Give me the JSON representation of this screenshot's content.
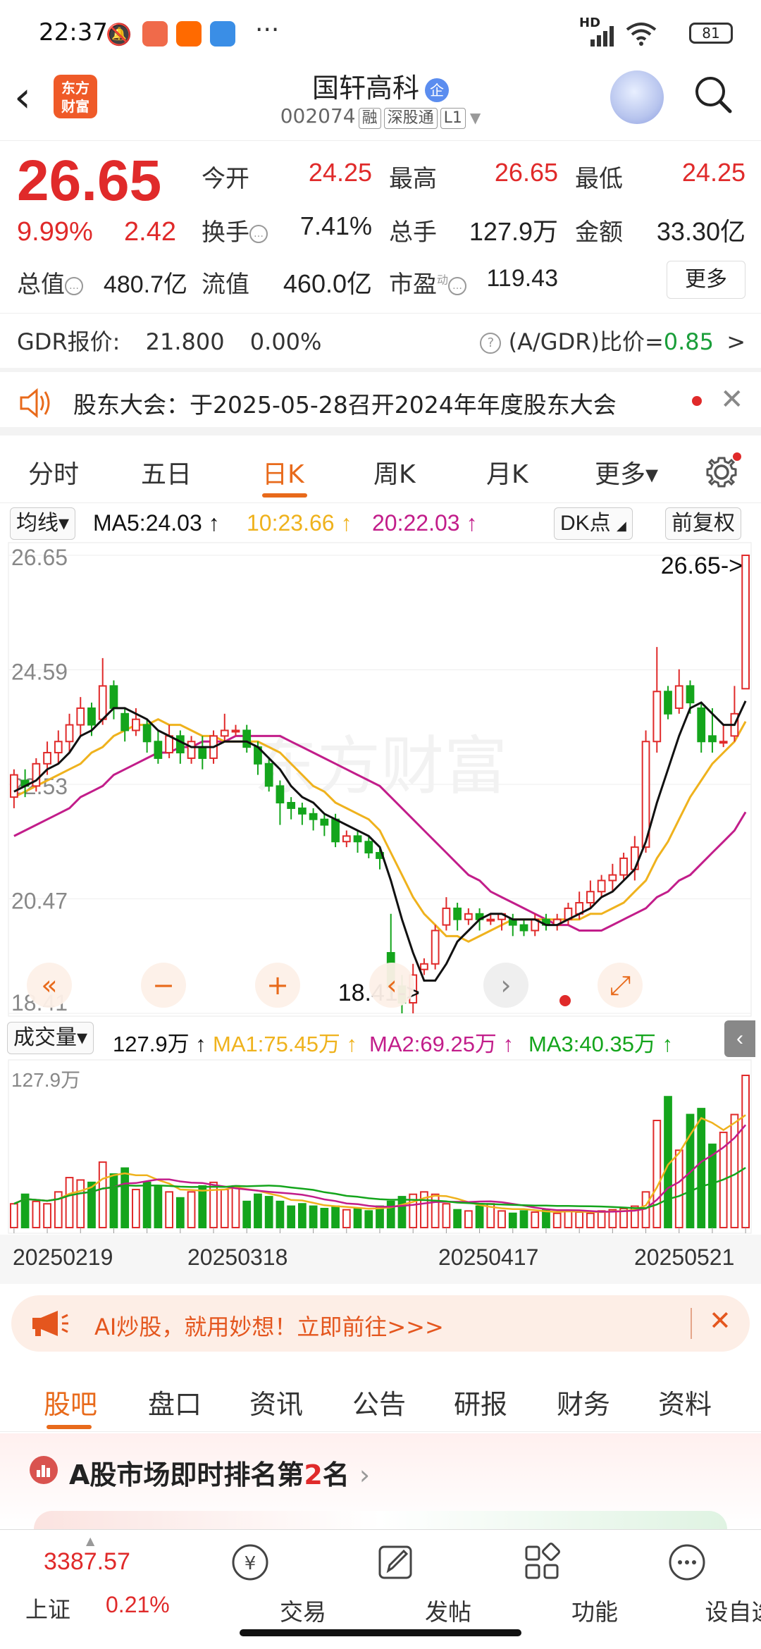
{
  "status_bar": {
    "time": "22:37",
    "battery": "81",
    "network": "HD"
  },
  "header": {
    "back_icon": "chevron-left-icon",
    "logo_text_1": "东方",
    "logo_text_2": "财富",
    "stock_name": "国轩高科",
    "badge": "企",
    "code": "002074",
    "tags": [
      "融",
      "深股通",
      "L1"
    ]
  },
  "quote": {
    "price": "26.65",
    "change_pct": "9.99%",
    "change": "2.42",
    "fields": {
      "open_label": "今开",
      "open": "24.25",
      "high_label": "最高",
      "high": "26.65",
      "low_label": "最低",
      "low": "24.25",
      "turnover_label": "换手",
      "turnover": "7.41%",
      "volume_label": "总手",
      "volume": "127.9万",
      "amount_label": "金额",
      "amount": "33.30亿",
      "mcap_label": "总值",
      "mcap": "480.7亿",
      "float_label": "流值",
      "float": "460.0亿",
      "pe_label": "市盈",
      "pe_sup": "动",
      "pe": "119.43"
    },
    "more_button": "更多"
  },
  "gdr": {
    "label": "GDR报价:",
    "price": "21.800",
    "pct": "0.00%",
    "ratio_label": "(A/GDR)比价=",
    "ratio": "0.85",
    "arrow": ">"
  },
  "notice": {
    "text": "股东大会：于2025-05-28召开2024年年度股东大会"
  },
  "period_tabs": [
    {
      "label": "分时"
    },
    {
      "label": "五日"
    },
    {
      "label": "日K",
      "active": true
    },
    {
      "label": "周K"
    },
    {
      "label": "月K"
    },
    {
      "label": "更多▾"
    }
  ],
  "ma_row": {
    "selector": "均线▾",
    "ma5": "MA5:24.03",
    "ma10": "10:23.66",
    "ma20": "20:22.03",
    "up_arrow": "↑",
    "dk": "DK点",
    "adjust": "前复权"
  },
  "colors": {
    "up": "#e02a2a",
    "down": "#14a51c",
    "ma5": "#111111",
    "ma10": "#efb21d",
    "ma20": "#c21d8a",
    "accent": "#e86a1b"
  },
  "chart_data": {
    "type": "candlestick",
    "y_ticks": [
      "26.65",
      "24.59",
      "22.53",
      "20.47",
      "18.41"
    ],
    "ylim": [
      18.41,
      26.65
    ],
    "max_label": "26.65->",
    "min_label": "18.41->",
    "x_ticks": [
      "20250219",
      "20250318",
      "20250417",
      "20250521"
    ],
    "candles": [
      [
        22.3,
        22.7,
        22.1,
        22.8
      ],
      [
        22.6,
        22.5,
        22.3,
        22.8
      ],
      [
        22.5,
        22.9,
        22.4,
        23.0
      ],
      [
        22.9,
        23.1,
        22.7,
        23.3
      ],
      [
        23.1,
        23.3,
        22.9,
        23.5
      ],
      [
        23.3,
        23.6,
        23.1,
        23.8
      ],
      [
        23.6,
        23.9,
        23.4,
        24.1
      ],
      [
        23.9,
        23.6,
        23.4,
        24.0
      ],
      [
        23.7,
        24.3,
        23.6,
        24.8
      ],
      [
        24.3,
        23.9,
        23.7,
        24.4
      ],
      [
        23.8,
        23.5,
        23.3,
        23.9
      ],
      [
        23.5,
        23.7,
        23.4,
        23.9
      ],
      [
        23.6,
        23.3,
        23.1,
        23.7
      ],
      [
        23.3,
        23.0,
        22.9,
        23.5
      ],
      [
        23.1,
        23.4,
        23.0,
        23.6
      ],
      [
        23.4,
        23.1,
        22.9,
        23.5
      ],
      [
        23.0,
        23.3,
        22.9,
        23.4
      ],
      [
        23.2,
        23.0,
        22.8,
        23.4
      ],
      [
        23.0,
        23.4,
        22.9,
        23.5
      ],
      [
        23.4,
        23.5,
        23.3,
        23.8
      ],
      [
        23.5,
        23.5,
        23.4,
        23.6
      ],
      [
        23.5,
        23.2,
        23.1,
        23.6
      ],
      [
        23.2,
        22.9,
        22.7,
        23.3
      ],
      [
        22.9,
        22.5,
        22.4,
        23.0
      ],
      [
        22.5,
        22.2,
        21.8,
        22.6
      ],
      [
        22.2,
        22.1,
        21.9,
        22.3
      ],
      [
        22.1,
        22.0,
        21.8,
        22.2
      ],
      [
        22.0,
        21.9,
        21.7,
        22.1
      ],
      [
        21.9,
        21.8,
        21.6,
        22.0
      ],
      [
        21.9,
        21.5,
        21.4,
        22.0
      ],
      [
        21.5,
        21.6,
        21.4,
        21.7
      ],
      [
        21.6,
        21.5,
        21.3,
        21.7
      ],
      [
        21.5,
        21.3,
        21.2,
        21.6
      ],
      [
        21.3,
        21.2,
        21.0,
        21.4
      ],
      [
        19.5,
        18.9,
        18.7,
        20.2
      ],
      [
        18.9,
        18.6,
        18.41,
        19.1
      ],
      [
        18.6,
        19.1,
        18.41,
        19.3
      ],
      [
        19.2,
        19.3,
        19.1,
        19.4
      ],
      [
        19.3,
        19.9,
        19.2,
        20.0
      ],
      [
        20.0,
        20.3,
        19.9,
        20.5
      ],
      [
        20.3,
        20.1,
        19.9,
        20.4
      ],
      [
        20.1,
        20.2,
        20.0,
        20.3
      ],
      [
        20.2,
        20.1,
        19.9,
        20.3
      ],
      [
        20.1,
        20.1,
        20.0,
        20.2
      ],
      [
        20.1,
        20.2,
        19.9,
        20.2
      ],
      [
        20.1,
        20.0,
        19.8,
        20.2
      ],
      [
        20.0,
        19.9,
        19.8,
        20.1
      ],
      [
        19.9,
        20.1,
        19.8,
        20.2
      ],
      [
        20.1,
        20.0,
        19.9,
        20.2
      ],
      [
        20.0,
        20.1,
        19.9,
        20.2
      ],
      [
        20.1,
        20.3,
        20.0,
        20.4
      ],
      [
        20.2,
        20.4,
        20.1,
        20.6
      ],
      [
        20.4,
        20.6,
        20.3,
        20.8
      ],
      [
        20.6,
        20.8,
        20.5,
        20.9
      ],
      [
        20.8,
        20.9,
        20.6,
        21.1
      ],
      [
        20.9,
        21.2,
        20.8,
        21.3
      ],
      [
        21.0,
        21.4,
        20.8,
        21.6
      ],
      [
        21.4,
        23.3,
        21.3,
        23.5
      ],
      [
        23.3,
        24.2,
        23.1,
        25.0
      ],
      [
        24.2,
        23.8,
        23.7,
        24.3
      ],
      [
        23.9,
        24.3,
        23.8,
        24.6
      ],
      [
        24.3,
        24.0,
        23.8,
        24.4
      ],
      [
        23.9,
        23.3,
        23.1,
        24.0
      ],
      [
        23.4,
        23.3,
        23.1,
        23.9
      ],
      [
        23.3,
        23.3,
        23.2,
        23.6
      ],
      [
        23.4,
        23.8,
        23.3,
        24.3
      ],
      [
        24.25,
        26.65,
        24.25,
        26.65
      ]
    ],
    "ma5": [
      22.4,
      22.5,
      22.6,
      22.8,
      22.9,
      23.1,
      23.4,
      23.5,
      23.7,
      23.9,
      23.9,
      23.8,
      23.7,
      23.5,
      23.4,
      23.3,
      23.2,
      23.2,
      23.2,
      23.3,
      23.3,
      23.3,
      23.2,
      23.0,
      22.8,
      22.5,
      22.3,
      22.2,
      22.0,
      21.9,
      21.8,
      21.7,
      21.6,
      21.4,
      20.8,
      20.1,
      19.5,
      19.0,
      19.0,
      19.3,
      19.7,
      19.9,
      20.1,
      20.2,
      20.2,
      20.1,
      20.1,
      20.1,
      20.0,
      20.0,
      20.1,
      20.2,
      20.3,
      20.5,
      20.6,
      20.8,
      21.0,
      21.5,
      22.2,
      22.8,
      23.4,
      23.9,
      24.0,
      23.8,
      23.6,
      23.6,
      24.03
    ],
    "ma10": [
      22.3,
      22.4,
      22.5,
      22.6,
      22.7,
      22.8,
      22.9,
      23.1,
      23.2,
      23.4,
      23.5,
      23.6,
      23.6,
      23.7,
      23.6,
      23.6,
      23.5,
      23.4,
      23.4,
      23.3,
      23.3,
      23.3,
      23.3,
      23.2,
      23.1,
      22.9,
      22.7,
      22.5,
      22.4,
      22.2,
      22.1,
      22.0,
      21.9,
      21.7,
      21.3,
      20.9,
      20.5,
      20.2,
      20.0,
      19.8,
      19.8,
      19.7,
      19.8,
      19.9,
      20.0,
      20.1,
      20.1,
      20.1,
      20.1,
      20.1,
      20.1,
      20.1,
      20.2,
      20.2,
      20.3,
      20.4,
      20.6,
      20.8,
      21.2,
      21.5,
      21.9,
      22.3,
      22.6,
      22.9,
      23.1,
      23.3,
      23.66
    ],
    "ma20": [
      21.6,
      21.7,
      21.8,
      21.9,
      22.0,
      22.1,
      22.3,
      22.4,
      22.5,
      22.7,
      22.8,
      22.9,
      23.0,
      23.1,
      23.1,
      23.2,
      23.2,
      23.3,
      23.3,
      23.3,
      23.4,
      23.4,
      23.4,
      23.4,
      23.4,
      23.3,
      23.2,
      23.1,
      23.0,
      22.9,
      22.8,
      22.7,
      22.6,
      22.5,
      22.3,
      22.1,
      21.9,
      21.7,
      21.5,
      21.3,
      21.1,
      20.9,
      20.8,
      20.6,
      20.5,
      20.4,
      20.3,
      20.2,
      20.1,
      20.0,
      20.0,
      19.9,
      19.9,
      19.9,
      20.0,
      20.1,
      20.2,
      20.3,
      20.5,
      20.6,
      20.8,
      20.9,
      21.1,
      21.3,
      21.5,
      21.7,
      22.03
    ]
  },
  "volume_row": {
    "selector": "成交量▾",
    "vol": "127.9万",
    "ma1": "MA1:75.45万",
    "ma2": "MA2:69.25万",
    "ma3": "MA3:40.35万",
    "up_arrow": "↑"
  },
  "volume_data": {
    "top_label": "127.9万",
    "values": [
      20,
      28,
      22,
      20,
      30,
      42,
      40,
      38,
      55,
      45,
      50,
      32,
      38,
      35,
      30,
      25,
      30,
      35,
      38,
      32,
      35,
      22,
      28,
      26,
      22,
      18,
      20,
      18,
      16,
      18,
      15,
      16,
      14,
      18,
      22,
      26,
      28,
      30,
      28,
      20,
      15,
      14,
      18,
      20,
      14,
      12,
      14,
      13,
      15,
      12,
      14,
      13,
      12,
      14,
      15,
      16,
      18,
      30,
      90,
      110,
      65,
      95,
      100,
      70,
      80,
      95,
      127.9
    ]
  },
  "banner": {
    "text": "AI炒股，就用妙想！立即前往>>>"
  },
  "bottom_tabs": [
    {
      "label": "股吧",
      "active": true
    },
    {
      "label": "盘口"
    },
    {
      "label": "资讯"
    },
    {
      "label": "公告"
    },
    {
      "label": "研报"
    },
    {
      "label": "财务"
    },
    {
      "label": "资料"
    }
  ],
  "rank": {
    "prefix": "A股市场即时排名第",
    "rank": "2",
    "suffix": "名"
  },
  "bottom_nav": {
    "index_value": "3387.57",
    "index_name": "上证",
    "index_pct": "0.21%",
    "items": [
      {
        "label": "交易",
        "icon": "yen-icon"
      },
      {
        "label": "发帖",
        "icon": "edit-icon"
      },
      {
        "label": "功能",
        "icon": "grid-icon"
      },
      {
        "label": "设自选",
        "icon": "more-icon"
      }
    ]
  }
}
